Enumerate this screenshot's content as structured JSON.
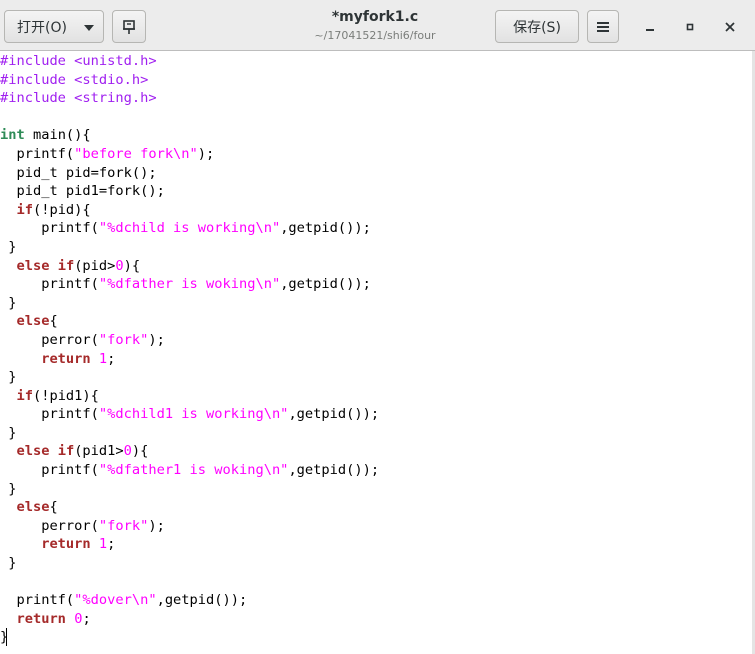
{
  "header": {
    "open_label": "打开(O)",
    "save_label": "保存(S)",
    "title": "*myfork1.c",
    "path": "~/17041521/shi6/four"
  },
  "icons": {
    "open_dropdown": "chevron-down-icon",
    "pin": "pin-icon",
    "menu": "hamburger-menu-icon",
    "minimize": "minimize-icon",
    "maximize": "maximize-icon",
    "close": "close-icon"
  },
  "syntax_colors": {
    "preprocessor": "#a020f0",
    "type": "#2e8b57",
    "keyword": "#a52a2a",
    "string": "#ff00ff",
    "number": "#ff00ff"
  },
  "code_lines": [
    [
      [
        "pp",
        "#include <unistd.h>"
      ]
    ],
    [
      [
        "pp",
        "#include <stdio.h>"
      ]
    ],
    [
      [
        "pp",
        "#include <string.h>"
      ]
    ],
    [],
    [
      [
        "ty",
        "int"
      ],
      [
        "",
        " main(){"
      ]
    ],
    [
      [
        "",
        "  printf("
      ],
      [
        "st",
        "\"before fork\\n\""
      ],
      [
        "",
        ");"
      ]
    ],
    [
      [
        "",
        "  pid_t pid=fork();"
      ]
    ],
    [
      [
        "",
        "  pid_t pid1=fork();"
      ]
    ],
    [
      [
        "",
        "  "
      ],
      [
        "kw",
        "if"
      ],
      [
        "",
        "(!pid){"
      ]
    ],
    [
      [
        "",
        "     printf("
      ],
      [
        "st",
        "\"%dchild is working\\n\""
      ],
      [
        "",
        ",getpid());"
      ]
    ],
    [
      [
        "",
        " }"
      ]
    ],
    [
      [
        "",
        "  "
      ],
      [
        "kw",
        "else"
      ],
      [
        "",
        " "
      ],
      [
        "kw",
        "if"
      ],
      [
        "",
        "(pid>"
      ],
      [
        "nm",
        "0"
      ],
      [
        "",
        "){"
      ]
    ],
    [
      [
        "",
        "     printf("
      ],
      [
        "st",
        "\"%dfather is woking\\n\""
      ],
      [
        "",
        ",getpid());"
      ]
    ],
    [
      [
        "",
        " }"
      ]
    ],
    [
      [
        "",
        "  "
      ],
      [
        "kw",
        "else"
      ],
      [
        "",
        "{"
      ]
    ],
    [
      [
        "",
        "     perror("
      ],
      [
        "st",
        "\"fork\""
      ],
      [
        "",
        ");"
      ]
    ],
    [
      [
        "",
        "     "
      ],
      [
        "kw",
        "return"
      ],
      [
        "",
        " "
      ],
      [
        "nm",
        "1"
      ],
      [
        "",
        ";"
      ]
    ],
    [
      [
        "",
        " }"
      ]
    ],
    [
      [
        "",
        "  "
      ],
      [
        "kw",
        "if"
      ],
      [
        "",
        "(!pid1){"
      ]
    ],
    [
      [
        "",
        "     printf("
      ],
      [
        "st",
        "\"%dchild1 is working\\n\""
      ],
      [
        "",
        ",getpid());"
      ]
    ],
    [
      [
        "",
        " }"
      ]
    ],
    [
      [
        "",
        "  "
      ],
      [
        "kw",
        "else"
      ],
      [
        "",
        " "
      ],
      [
        "kw",
        "if"
      ],
      [
        "",
        "(pid1>"
      ],
      [
        "nm",
        "0"
      ],
      [
        "",
        "){"
      ]
    ],
    [
      [
        "",
        "     printf("
      ],
      [
        "st",
        "\"%dfather1 is woking\\n\""
      ],
      [
        "",
        ",getpid());"
      ]
    ],
    [
      [
        "",
        " }"
      ]
    ],
    [
      [
        "",
        "  "
      ],
      [
        "kw",
        "else"
      ],
      [
        "",
        "{"
      ]
    ],
    [
      [
        "",
        "     perror("
      ],
      [
        "st",
        "\"fork\""
      ],
      [
        "",
        ");"
      ]
    ],
    [
      [
        "",
        "     "
      ],
      [
        "kw",
        "return"
      ],
      [
        "",
        " "
      ],
      [
        "nm",
        "1"
      ],
      [
        "",
        ";"
      ]
    ],
    [
      [
        "",
        " }"
      ]
    ],
    [],
    [
      [
        "",
        "  printf("
      ],
      [
        "st",
        "\"%dover\\n\""
      ],
      [
        "",
        ",getpid());"
      ]
    ],
    [
      [
        "",
        "  "
      ],
      [
        "kw",
        "return"
      ],
      [
        "",
        " "
      ],
      [
        "nm",
        "0"
      ],
      [
        "",
        ";"
      ]
    ],
    [
      [
        "",
        "}"
      ]
    ]
  ]
}
